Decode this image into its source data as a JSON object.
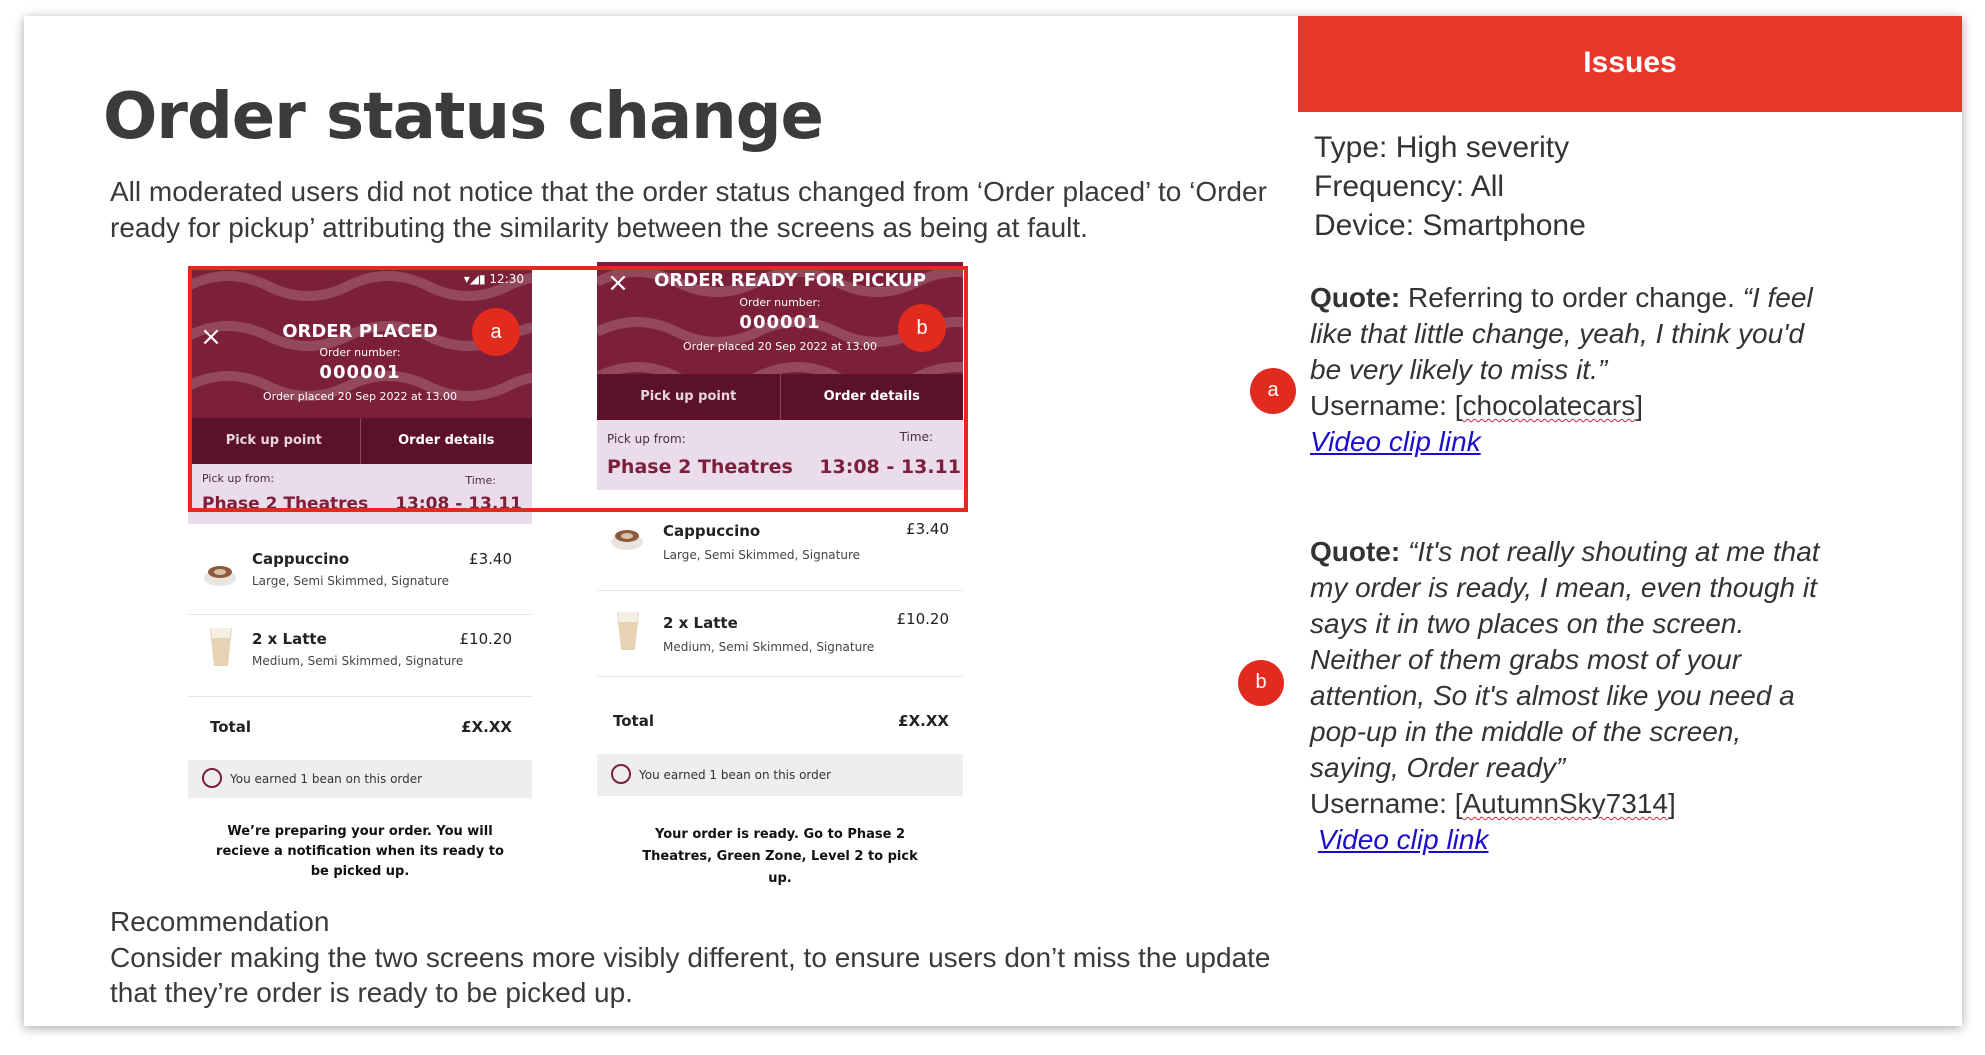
{
  "title": "Order status change",
  "intro": "All moderated users did not notice that the order status changed from ‘Order placed’ to ‘Order ready for pickup’ attributing the similarity between the screens as being at fault.",
  "recommendation": {
    "heading": "Recommendation",
    "text": "Consider making the two screens more visibly different, to ensure users don’t miss the update that they’re order is ready to be picked up."
  },
  "issues": {
    "header": "Issues",
    "type": "Type: High severity",
    "frequency": "Frequency: All",
    "device": "Device: Smartphone"
  },
  "quotes": [
    {
      "badge": "a",
      "label": "Quote:",
      "lead": " Referring to order change. ",
      "text": "“I feel like that little change, yeah, I think you'd be very likely to miss it.”",
      "username_prefix": "Username: [",
      "username": "chocolatecars",
      "username_suffix": "]",
      "link": "Video clip link"
    },
    {
      "badge": "b",
      "label": "Quote:",
      "lead": " ",
      "text": "“It's not really shouting at me that my order is ready, I mean, even though it says it in two places on the screen. Neither of them grabs most of your attention, So it's almost like you need a pop-up in the middle of the screen, saying, Order ready”",
      "username_prefix": "Username: [",
      "username": "AutumnSky7314",
      "username_suffix": "]",
      "link": "Video clip link"
    }
  ],
  "phones": [
    {
      "badge": "a",
      "status_time": "12:30",
      "heading": "ORDER PLACED",
      "order_number_label": "Order number:",
      "order_number": "000001",
      "placed": "Order placed 20 Sep 2022 at 13.00",
      "tabs": [
        "Pick up point",
        "Order details"
      ],
      "pickup_label": "Pick up from:",
      "time_label": "Time:",
      "pickup_place": "Phase 2 Theatres",
      "pickup_time": "13:08 - 13.11",
      "items": [
        {
          "name": "Cappuccino",
          "desc": "Large, Semi Skimmed, Signature",
          "price": "£3.40"
        },
        {
          "name": "2 x Latte",
          "desc": "Medium, Semi Skimmed, Signature",
          "price": "£10.20"
        }
      ],
      "total_label": "Total",
      "total_value": "£X.XX",
      "bean": "You earned 1 bean on this order",
      "message": "We’re preparing your order.  You will recieve a notification when its ready to be picked up."
    },
    {
      "badge": "b",
      "heading": "ORDER READY FOR PICKUP",
      "order_number_label": "Order number:",
      "order_number": "000001",
      "placed": "Order placed 20 Sep 2022 at 13.00",
      "tabs": [
        "Pick up point",
        "Order details"
      ],
      "pickup_label": "Pick up from:",
      "time_label": "Time:",
      "pickup_place": "Phase 2 Theatres",
      "pickup_time": "13:08 - 13.11",
      "items": [
        {
          "name": "Cappuccino",
          "desc": "Large, Semi Skimmed, Signature",
          "price": "£3.40"
        },
        {
          "name": "2 x Latte",
          "desc": "Medium, Semi Skimmed, Signature",
          "price": "£10.20"
        }
      ],
      "total_label": "Total",
      "total_value": "£X.XX",
      "bean": "You earned 1 bean on this order",
      "message": "Your order is ready. Go to Phase 2 Theatres, Green Zone, Level 2  to pick up."
    }
  ],
  "colors": {
    "accent": "#e8372a",
    "brand": "#7c1f3a",
    "link": "#1a0dcc"
  }
}
